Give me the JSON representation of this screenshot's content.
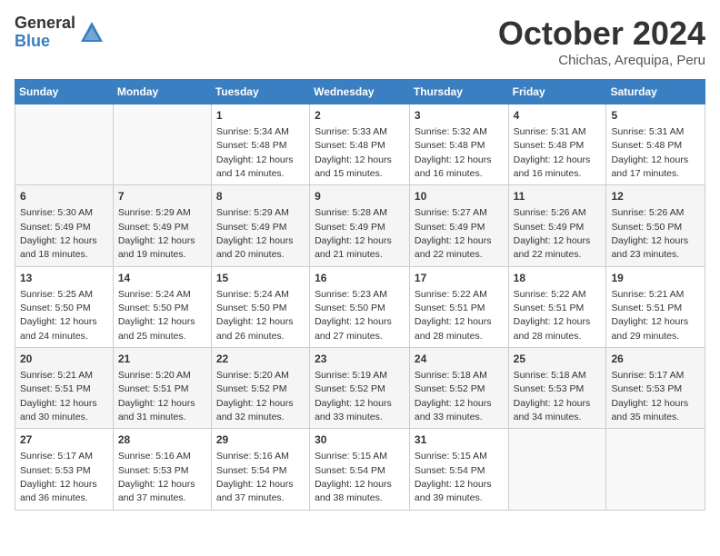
{
  "logo": {
    "general": "General",
    "blue": "Blue"
  },
  "title": "October 2024",
  "subtitle": "Chichas, Arequipa, Peru",
  "weekdays": [
    "Sunday",
    "Monday",
    "Tuesday",
    "Wednesday",
    "Thursday",
    "Friday",
    "Saturday"
  ],
  "weeks": [
    [
      {
        "day": "",
        "info": ""
      },
      {
        "day": "",
        "info": ""
      },
      {
        "day": "1",
        "info": "Sunrise: 5:34 AM\nSunset: 5:48 PM\nDaylight: 12 hours and 14 minutes."
      },
      {
        "day": "2",
        "info": "Sunrise: 5:33 AM\nSunset: 5:48 PM\nDaylight: 12 hours and 15 minutes."
      },
      {
        "day": "3",
        "info": "Sunrise: 5:32 AM\nSunset: 5:48 PM\nDaylight: 12 hours and 16 minutes."
      },
      {
        "day": "4",
        "info": "Sunrise: 5:31 AM\nSunset: 5:48 PM\nDaylight: 12 hours and 16 minutes."
      },
      {
        "day": "5",
        "info": "Sunrise: 5:31 AM\nSunset: 5:48 PM\nDaylight: 12 hours and 17 minutes."
      }
    ],
    [
      {
        "day": "6",
        "info": "Sunrise: 5:30 AM\nSunset: 5:49 PM\nDaylight: 12 hours and 18 minutes."
      },
      {
        "day": "7",
        "info": "Sunrise: 5:29 AM\nSunset: 5:49 PM\nDaylight: 12 hours and 19 minutes."
      },
      {
        "day": "8",
        "info": "Sunrise: 5:29 AM\nSunset: 5:49 PM\nDaylight: 12 hours and 20 minutes."
      },
      {
        "day": "9",
        "info": "Sunrise: 5:28 AM\nSunset: 5:49 PM\nDaylight: 12 hours and 21 minutes."
      },
      {
        "day": "10",
        "info": "Sunrise: 5:27 AM\nSunset: 5:49 PM\nDaylight: 12 hours and 22 minutes."
      },
      {
        "day": "11",
        "info": "Sunrise: 5:26 AM\nSunset: 5:49 PM\nDaylight: 12 hours and 22 minutes."
      },
      {
        "day": "12",
        "info": "Sunrise: 5:26 AM\nSunset: 5:50 PM\nDaylight: 12 hours and 23 minutes."
      }
    ],
    [
      {
        "day": "13",
        "info": "Sunrise: 5:25 AM\nSunset: 5:50 PM\nDaylight: 12 hours and 24 minutes."
      },
      {
        "day": "14",
        "info": "Sunrise: 5:24 AM\nSunset: 5:50 PM\nDaylight: 12 hours and 25 minutes."
      },
      {
        "day": "15",
        "info": "Sunrise: 5:24 AM\nSunset: 5:50 PM\nDaylight: 12 hours and 26 minutes."
      },
      {
        "day": "16",
        "info": "Sunrise: 5:23 AM\nSunset: 5:50 PM\nDaylight: 12 hours and 27 minutes."
      },
      {
        "day": "17",
        "info": "Sunrise: 5:22 AM\nSunset: 5:51 PM\nDaylight: 12 hours and 28 minutes."
      },
      {
        "day": "18",
        "info": "Sunrise: 5:22 AM\nSunset: 5:51 PM\nDaylight: 12 hours and 28 minutes."
      },
      {
        "day": "19",
        "info": "Sunrise: 5:21 AM\nSunset: 5:51 PM\nDaylight: 12 hours and 29 minutes."
      }
    ],
    [
      {
        "day": "20",
        "info": "Sunrise: 5:21 AM\nSunset: 5:51 PM\nDaylight: 12 hours and 30 minutes."
      },
      {
        "day": "21",
        "info": "Sunrise: 5:20 AM\nSunset: 5:51 PM\nDaylight: 12 hours and 31 minutes."
      },
      {
        "day": "22",
        "info": "Sunrise: 5:20 AM\nSunset: 5:52 PM\nDaylight: 12 hours and 32 minutes."
      },
      {
        "day": "23",
        "info": "Sunrise: 5:19 AM\nSunset: 5:52 PM\nDaylight: 12 hours and 33 minutes."
      },
      {
        "day": "24",
        "info": "Sunrise: 5:18 AM\nSunset: 5:52 PM\nDaylight: 12 hours and 33 minutes."
      },
      {
        "day": "25",
        "info": "Sunrise: 5:18 AM\nSunset: 5:53 PM\nDaylight: 12 hours and 34 minutes."
      },
      {
        "day": "26",
        "info": "Sunrise: 5:17 AM\nSunset: 5:53 PM\nDaylight: 12 hours and 35 minutes."
      }
    ],
    [
      {
        "day": "27",
        "info": "Sunrise: 5:17 AM\nSunset: 5:53 PM\nDaylight: 12 hours and 36 minutes."
      },
      {
        "day": "28",
        "info": "Sunrise: 5:16 AM\nSunset: 5:53 PM\nDaylight: 12 hours and 37 minutes."
      },
      {
        "day": "29",
        "info": "Sunrise: 5:16 AM\nSunset: 5:54 PM\nDaylight: 12 hours and 37 minutes."
      },
      {
        "day": "30",
        "info": "Sunrise: 5:15 AM\nSunset: 5:54 PM\nDaylight: 12 hours and 38 minutes."
      },
      {
        "day": "31",
        "info": "Sunrise: 5:15 AM\nSunset: 5:54 PM\nDaylight: 12 hours and 39 minutes."
      },
      {
        "day": "",
        "info": ""
      },
      {
        "day": "",
        "info": ""
      }
    ]
  ]
}
